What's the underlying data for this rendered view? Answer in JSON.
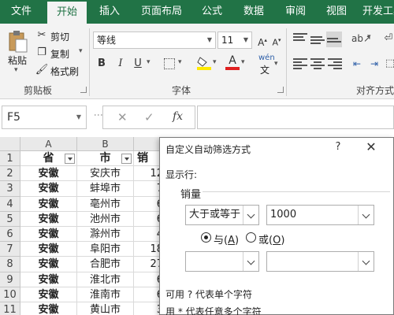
{
  "tabs": [
    "文件",
    "开始",
    "插入",
    "页面布局",
    "公式",
    "数据",
    "审阅",
    "视图",
    "开发工具"
  ],
  "ribbon": {
    "clipboard": {
      "paste": "粘贴",
      "cut": "剪切",
      "copy": "复制",
      "format_painter": "格式刷",
      "group": "剪贴板"
    },
    "font": {
      "name": "等线",
      "size": "11",
      "bold": "B",
      "italic": "I",
      "underline": "U",
      "wen": "wén",
      "group": "字体"
    },
    "align": {
      "group": "对齐方式"
    }
  },
  "formula_bar": {
    "name_box": "F5",
    "fx": "fx"
  },
  "columns": [
    "A",
    "B"
  ],
  "rows": [
    {
      "n": "1",
      "a": "省",
      "b": "市",
      "c": "销"
    },
    {
      "n": "2",
      "a": "安徽",
      "b": "安庆市",
      "c": "12"
    },
    {
      "n": "3",
      "a": "安徽",
      "b": "蚌埠市",
      "c": "7"
    },
    {
      "n": "4",
      "a": "安徽",
      "b": "亳州市",
      "c": "6"
    },
    {
      "n": "5",
      "a": "安徽",
      "b": "池州市",
      "c": "6"
    },
    {
      "n": "6",
      "a": "安徽",
      "b": "滁州市",
      "c": "4"
    },
    {
      "n": "7",
      "a": "安徽",
      "b": "阜阳市",
      "c": "18"
    },
    {
      "n": "8",
      "a": "安徽",
      "b": "合肥市",
      "c": "27"
    },
    {
      "n": "9",
      "a": "安徽",
      "b": "淮北市",
      "c": "6"
    },
    {
      "n": "10",
      "a": "安徽",
      "b": "淮南市",
      "c": "6"
    },
    {
      "n": "11",
      "a": "安徽",
      "b": "黄山市",
      "c": "3"
    }
  ],
  "dialog": {
    "title": "自定义自动筛选方式",
    "help": "?",
    "close": "✕",
    "show_rows": "显示行:",
    "field": "销量",
    "operator1": "大于或等于",
    "value1": "1000",
    "and_label": "与",
    "and_key": "A",
    "or_label": "或",
    "or_key": "O",
    "operator2": "",
    "value2": "",
    "hint1": "可用 ? 代表单个字符",
    "hint2": "用 * 代表任意多个字符"
  }
}
